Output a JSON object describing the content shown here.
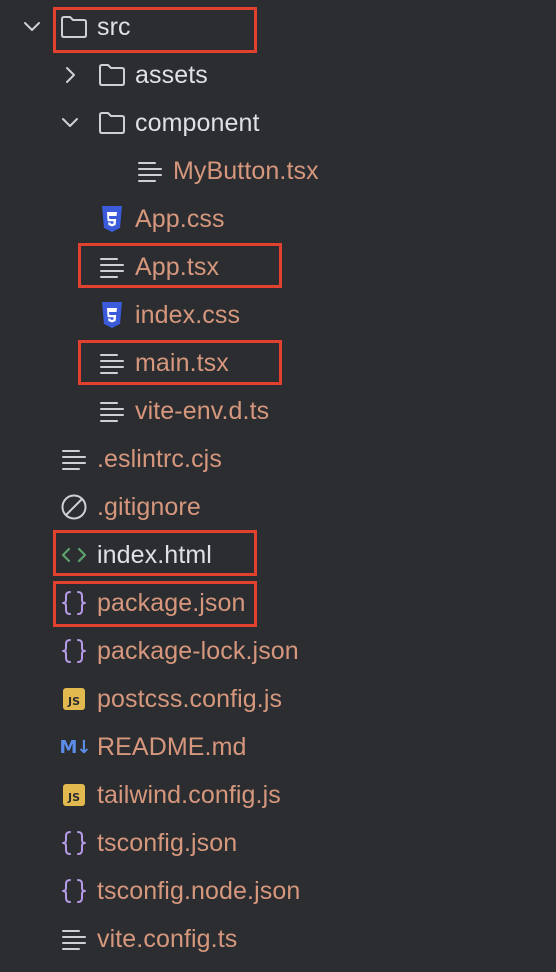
{
  "tree": {
    "src": {
      "label": "src"
    },
    "assets": {
      "label": "assets"
    },
    "component": {
      "label": "component"
    },
    "mybutton": {
      "label": "MyButton.tsx"
    },
    "app_css": {
      "label": "App.css"
    },
    "app_tsx": {
      "label": "App.tsx"
    },
    "index_css": {
      "label": "index.css"
    },
    "main_tsx": {
      "label": "main.tsx"
    },
    "vite_env": {
      "label": "vite-env.d.ts"
    },
    "eslintrc": {
      "label": ".eslintrc.cjs"
    },
    "gitignore": {
      "label": ".gitignore"
    },
    "index_html": {
      "label": "index.html"
    },
    "package_json": {
      "label": "package.json"
    },
    "package_lock": {
      "label": "package-lock.json"
    },
    "postcss": {
      "label": "postcss.config.js"
    },
    "readme": {
      "label": "README.md"
    },
    "tailwind": {
      "label": "tailwind.config.js"
    },
    "tsconfig": {
      "label": "tsconfig.json"
    },
    "tsconfig_node": {
      "label": "tsconfig.node.json"
    },
    "vite_config": {
      "label": "vite.config.ts"
    }
  },
  "icons": {
    "js_badge_text": "JS",
    "md_badge_text": "M↓"
  },
  "colors": {
    "background": "#2b2d30",
    "text_plain": "#dfe1e5",
    "text_modified": "#d6977d",
    "highlight_border": "#e2412f",
    "css_icon": "#3b5bdb",
    "html_icon": "#5fa16d",
    "json_icon": "#b79ae6",
    "js_badge": "#e2b94e",
    "md_badge": "#5c8de8"
  }
}
